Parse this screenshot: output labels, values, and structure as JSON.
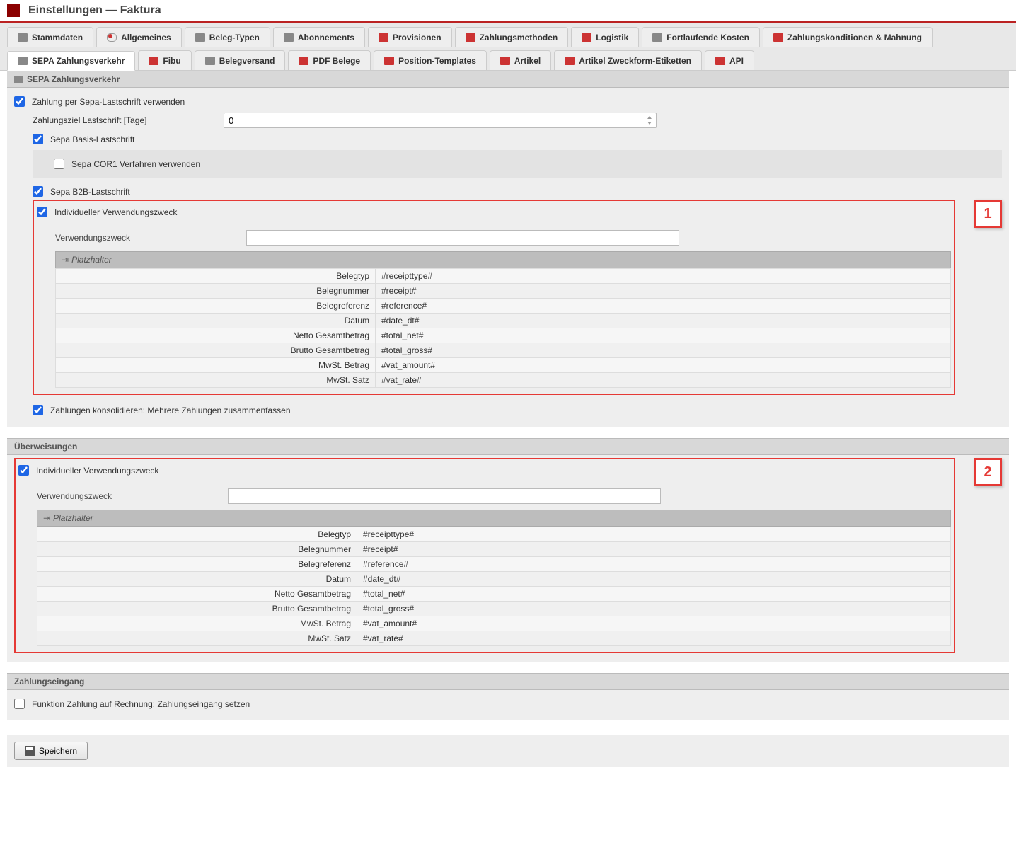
{
  "header": {
    "title": "Einstellungen — Faktura"
  },
  "tabs_row1": {
    "stammdaten": "Stammdaten",
    "allgemeines": "Allgemeines",
    "belegtypen": "Beleg-Typen",
    "abonnements": "Abonnements",
    "provisionen": "Provisionen",
    "zahlungsmethoden": "Zahlungsmethoden",
    "logistik": "Logistik",
    "fortlaufende": "Fortlaufende Kosten",
    "zahlungskonditionen": "Zahlungskonditionen & Mahnung"
  },
  "tabs_row2": {
    "sepa": "SEPA Zahlungsverkehr",
    "fibu": "Fibu",
    "belegversand": "Belegversand",
    "pdf": "PDF Belege",
    "postemplates": "Position-Templates",
    "artikel": "Artikel",
    "zweckform": "Artikel Zweckform-Etiketten",
    "api": "API"
  },
  "section1": {
    "title": "SEPA Zahlungsverkehr",
    "useSepa": "Zahlung per Sepa-Lastschrift verwenden",
    "zielLabel": "Zahlungsziel Lastschrift [Tage]",
    "zielValue": "0",
    "basis": "Sepa Basis-Lastschrift",
    "cor1": "Sepa COR1 Verfahren verwenden",
    "b2b": "Sepa B2B-Lastschrift",
    "indiv": "Individueller Verwendungszweck",
    "vzLabel": "Verwendungszweck",
    "phTitle": "Platzhalter",
    "consolidate": "Zahlungen konsolidieren: Mehrere Zahlungen zusammenfassen"
  },
  "placeholders": [
    {
      "label": "Belegtyp",
      "value": "#receipttype#"
    },
    {
      "label": "Belegnummer",
      "value": "#receipt#"
    },
    {
      "label": "Belegreferenz",
      "value": "#reference#"
    },
    {
      "label": "Datum",
      "value": "#date_dt#"
    },
    {
      "label": "Netto Gesamtbetrag",
      "value": "#total_net#"
    },
    {
      "label": "Brutto Gesamtbetrag",
      "value": "#total_gross#"
    },
    {
      "label": "MwSt. Betrag",
      "value": "#vat_amount#"
    },
    {
      "label": "MwSt. Satz",
      "value": "#vat_rate#"
    }
  ],
  "section2": {
    "title": "Überweisungen",
    "indiv": "Individueller Verwendungszweck",
    "vzLabel": "Verwendungszweck",
    "phTitle": "Platzhalter"
  },
  "section3": {
    "title": "Zahlungseingang",
    "funcLabel": "Funktion Zahlung auf Rechnung: Zahlungseingang setzen"
  },
  "badges": {
    "one": "1",
    "two": "2"
  },
  "footer": {
    "save": "Speichern"
  }
}
